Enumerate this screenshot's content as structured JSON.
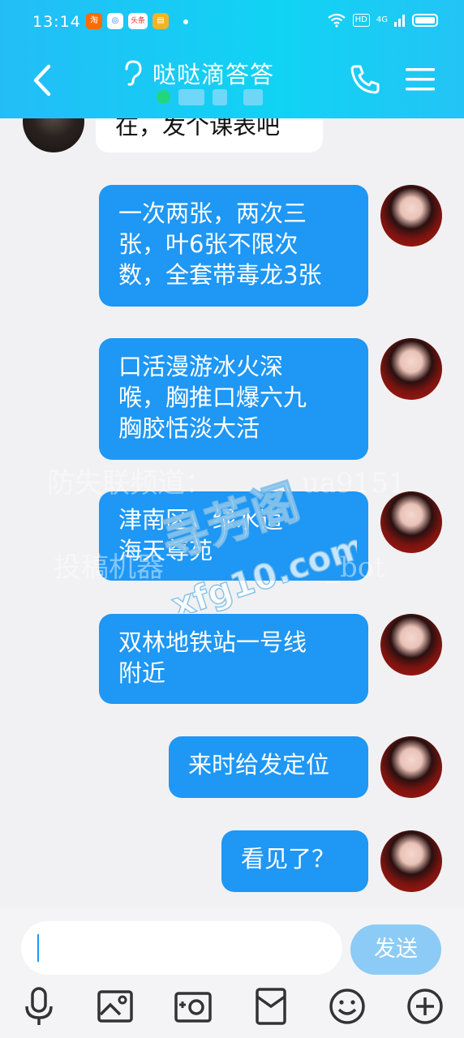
{
  "status_bar": {
    "time": "13:14",
    "app_icons": [
      {
        "name": "taobao-icon",
        "color": "#ff6a00",
        "glyph": "淘"
      },
      {
        "name": "music-icon",
        "color": "#2c7be5",
        "glyph": "◎"
      },
      {
        "name": "toutiao-icon",
        "color": "#e8302a",
        "glyph": "头条"
      },
      {
        "name": "note-icon",
        "color": "#f1b424",
        "glyph": "▤"
      }
    ],
    "hd_label": "HD",
    "network_label": "4G"
  },
  "header": {
    "title": "哒哒滴答答",
    "accent_color": "#1fc8f5",
    "online_color": "#22d67e"
  },
  "messages": [
    {
      "id": "m0",
      "side": "left",
      "text": "在，发个课表吧"
    },
    {
      "id": "m1",
      "side": "right",
      "text": "一次两张，两次三\n张，叶6张不限次\n数，全套带毒龙3张"
    },
    {
      "id": "m2",
      "side": "right",
      "text": "口活漫游冰火深\n喉，胸推口爆六九\n胸胶恬淡大活"
    },
    {
      "id": "m3",
      "side": "right",
      "text": "津南区，绿水道\n海天尊苑"
    },
    {
      "id": "m4",
      "side": "right",
      "text": "双林地铁站一号线\n附近"
    },
    {
      "id": "m5",
      "side": "right",
      "text": "来时给发定位"
    },
    {
      "id": "m6",
      "side": "right",
      "text": "看见了？"
    }
  ],
  "watermarks": {
    "line1": "防失联频道：",
    "line1_tail": "ua9151",
    "line2": "投稿机器",
    "line2_tail": "_bot",
    "site_logo_cn": "寻芳阁",
    "site_logo_url": "xfg10.com"
  },
  "composer": {
    "input_value": "",
    "send_label": "发送",
    "bubble_color": "#1e97f5",
    "send_color": "#8ccbf6"
  },
  "toolbar": {
    "tools": [
      "microphone-icon",
      "image-icon",
      "camera-icon",
      "red-packet-icon",
      "emoji-icon",
      "plus-icon"
    ]
  }
}
